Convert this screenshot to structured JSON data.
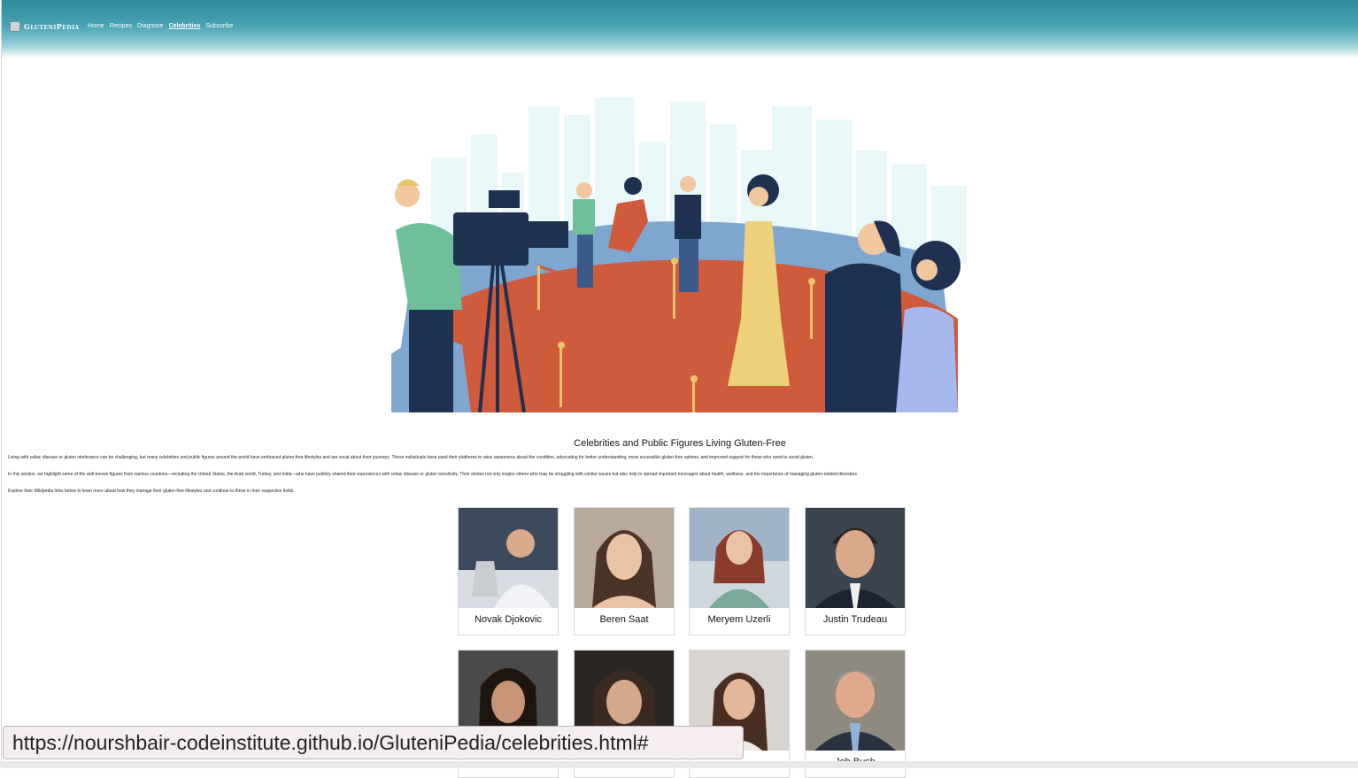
{
  "brand": {
    "name": "GluteniPedia"
  },
  "nav": {
    "links": [
      {
        "label": "Home"
      },
      {
        "label": "Recipes"
      },
      {
        "label": "Diagnose"
      },
      {
        "label": "Celebrities",
        "active": true
      },
      {
        "label": "Subscribe"
      }
    ]
  },
  "intro": {
    "title": "Celebrities and Public Figures Living Gluten-Free",
    "paragraphs": [
      "Living with celiac disease or gluten intolerance can be challenging, but many celebrities and public figures around the world have embraced gluten-free lifestyles and are vocal about their journeys. These individuals have used their platforms to raise awareness about the condition, advocating for better understanding, more accessible gluten-free options, and improved support for those who need to avoid gluten.",
      "In this section, we highlight some of the well-known figures from various countries—including the United States, the Arab world, Turkey, and India—who have publicly shared their experiences with celiac disease or gluten sensitivity. Their stories not only inspire others who may be struggling with similar issues but also help to spread important messages about health, wellness, and the importance of managing gluten-related disorders.",
      "Explore their Wikipedia links below to learn more about how they manage their gluten-free lifestyles and continue to thrive in their respective fields."
    ]
  },
  "celebrities": [
    {
      "name": "Novak Djokovic"
    },
    {
      "name": "Beren Saat"
    },
    {
      "name": "Meryem Uzerli"
    },
    {
      "name": "Justin Trudeau"
    },
    {
      "name": ""
    },
    {
      "name": ""
    },
    {
      "name": ""
    },
    {
      "name": "Jeb Bush"
    }
  ],
  "status_bar": {
    "url": "https://nourshbair-codeinstitute.github.io/GluteniPedia/celebrities.html#"
  },
  "colors": {
    "nav_top": "#2e8a9a",
    "nav_bottom": "#8fcbd4",
    "carpet": "#cf5a3c",
    "stage": "#7fa6cf"
  }
}
